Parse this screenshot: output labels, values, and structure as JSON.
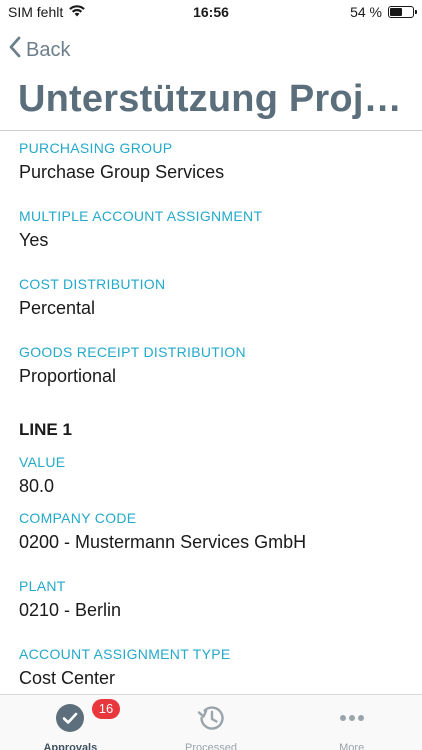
{
  "status_bar": {
    "carrier": "SIM fehlt",
    "time": "16:56",
    "battery_percent": "54 %",
    "battery_level": 0.54
  },
  "nav": {
    "back_label": "Back",
    "title": "Unterstützung Proje…"
  },
  "fields": [
    {
      "label": "PURCHASING GROUP",
      "value": "Purchase Group Services"
    },
    {
      "label": "MULTIPLE ACCOUNT ASSIGNMENT",
      "value": "Yes"
    },
    {
      "label": "COST DISTRIBUTION",
      "value": "Percental"
    },
    {
      "label": "GOODS RECEIPT DISTRIBUTION",
      "value": "Proportional"
    }
  ],
  "line_section": {
    "heading": "LINE 1",
    "fields": [
      {
        "label": "VALUE",
        "value": "80.0"
      },
      {
        "label": "COMPANY CODE",
        "value": "0200 - Mustermann Services GmbH"
      },
      {
        "label": "PLANT",
        "value": "0210 - Berlin"
      },
      {
        "label": "ACCOUNT ASSIGNMENT TYPE",
        "value": "Cost Center"
      }
    ]
  },
  "tab_bar": {
    "tabs": [
      {
        "label": "Approvals",
        "icon": "check-circle-icon",
        "badge": "16",
        "active": true
      },
      {
        "label": "Processed",
        "icon": "history-icon",
        "active": false
      },
      {
        "label": "More",
        "icon": "more-dots-icon",
        "active": false
      }
    ]
  },
  "colors": {
    "accent_label": "#23a9c9",
    "title": "#5a6e7c",
    "badge": "#e8383d"
  }
}
